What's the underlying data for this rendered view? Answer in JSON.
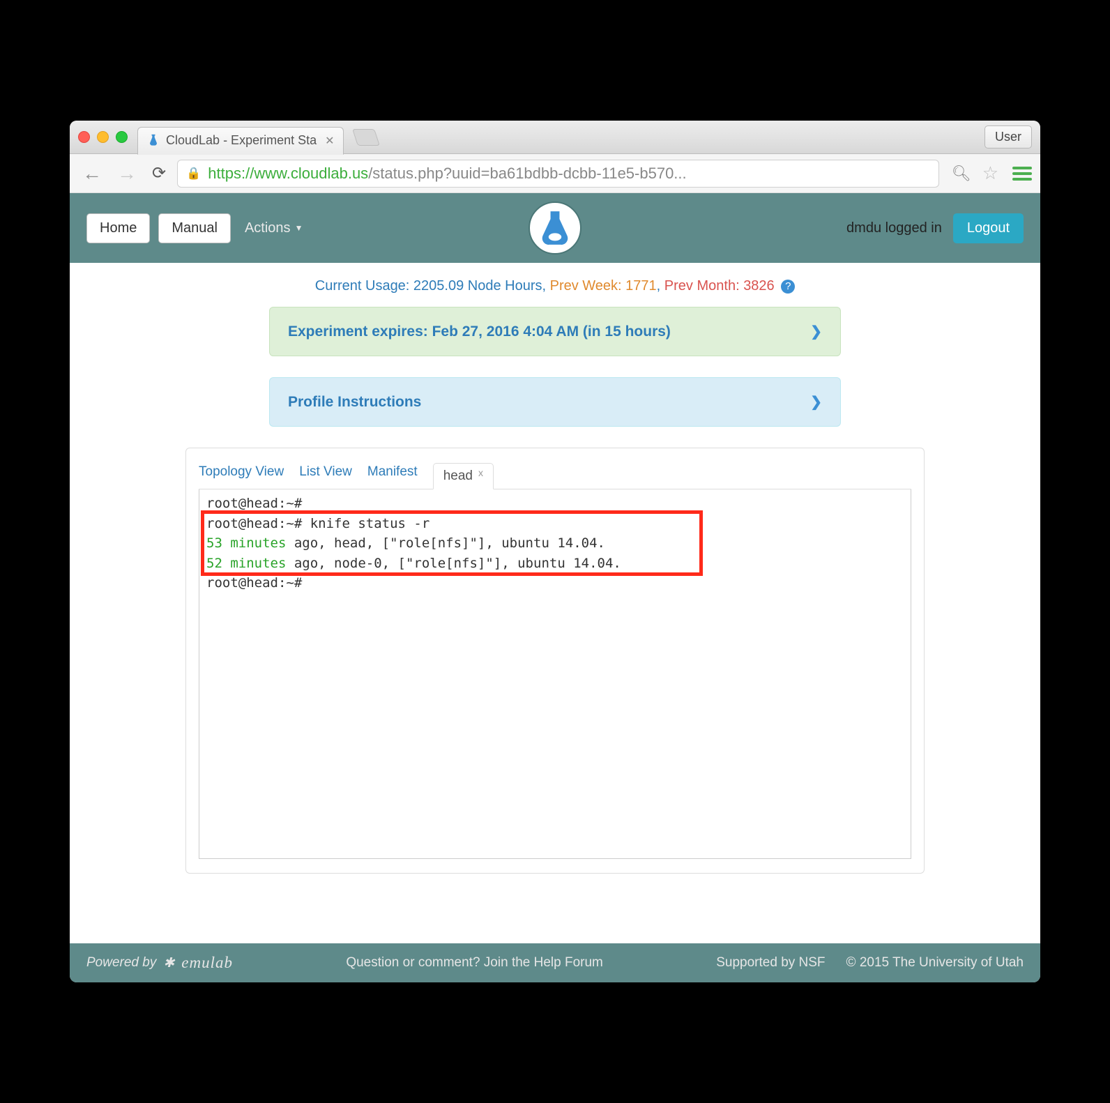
{
  "browser": {
    "tab_title": "CloudLab - Experiment Sta",
    "user_button": "User",
    "url_scheme": "https",
    "url_host": "://www.cloudlab.us",
    "url_path": "/status.php?uuid=ba61bdbb-dcbb-11e5-b570..."
  },
  "nav": {
    "home": "Home",
    "manual": "Manual",
    "actions": "Actions",
    "logged_in": "dmdu logged in",
    "logout": "Logout"
  },
  "usage": {
    "label": "Current Usage: ",
    "hours": "2205.09 Node Hours, ",
    "prev_week_label": "Prev Week: ",
    "prev_week_val": "1771",
    "sep": ", ",
    "prev_month_label": "Prev Month: ",
    "prev_month_val": "3826"
  },
  "panels": {
    "expire": "Experiment expires: Feb 27, 2016 4:04 AM (in 15 hours)",
    "instructions": "Profile Instructions"
  },
  "tabs": {
    "topology": "Topology View",
    "list": "List View",
    "manifest": "Manifest",
    "head": "head"
  },
  "terminal": {
    "line1": "root@head:~#",
    "line2_prompt": "root@head:~# ",
    "line2_cmd": "knife status -r",
    "line3_time": "53 minutes",
    "line3_rest": " ago, head, [\"role[nfs]\"], ubuntu 14.04.",
    "line4_time": "52 minutes",
    "line4_rest": " ago, node-0, [\"role[nfs]\"], ubuntu 14.04.",
    "line5": "root@head:~#"
  },
  "footer": {
    "powered": "Powered by ",
    "brand": "emulab",
    "question": "Question or comment? Join the Help Forum",
    "nsf": "Supported by NSF",
    "copy": "© 2015 The University of Utah"
  }
}
